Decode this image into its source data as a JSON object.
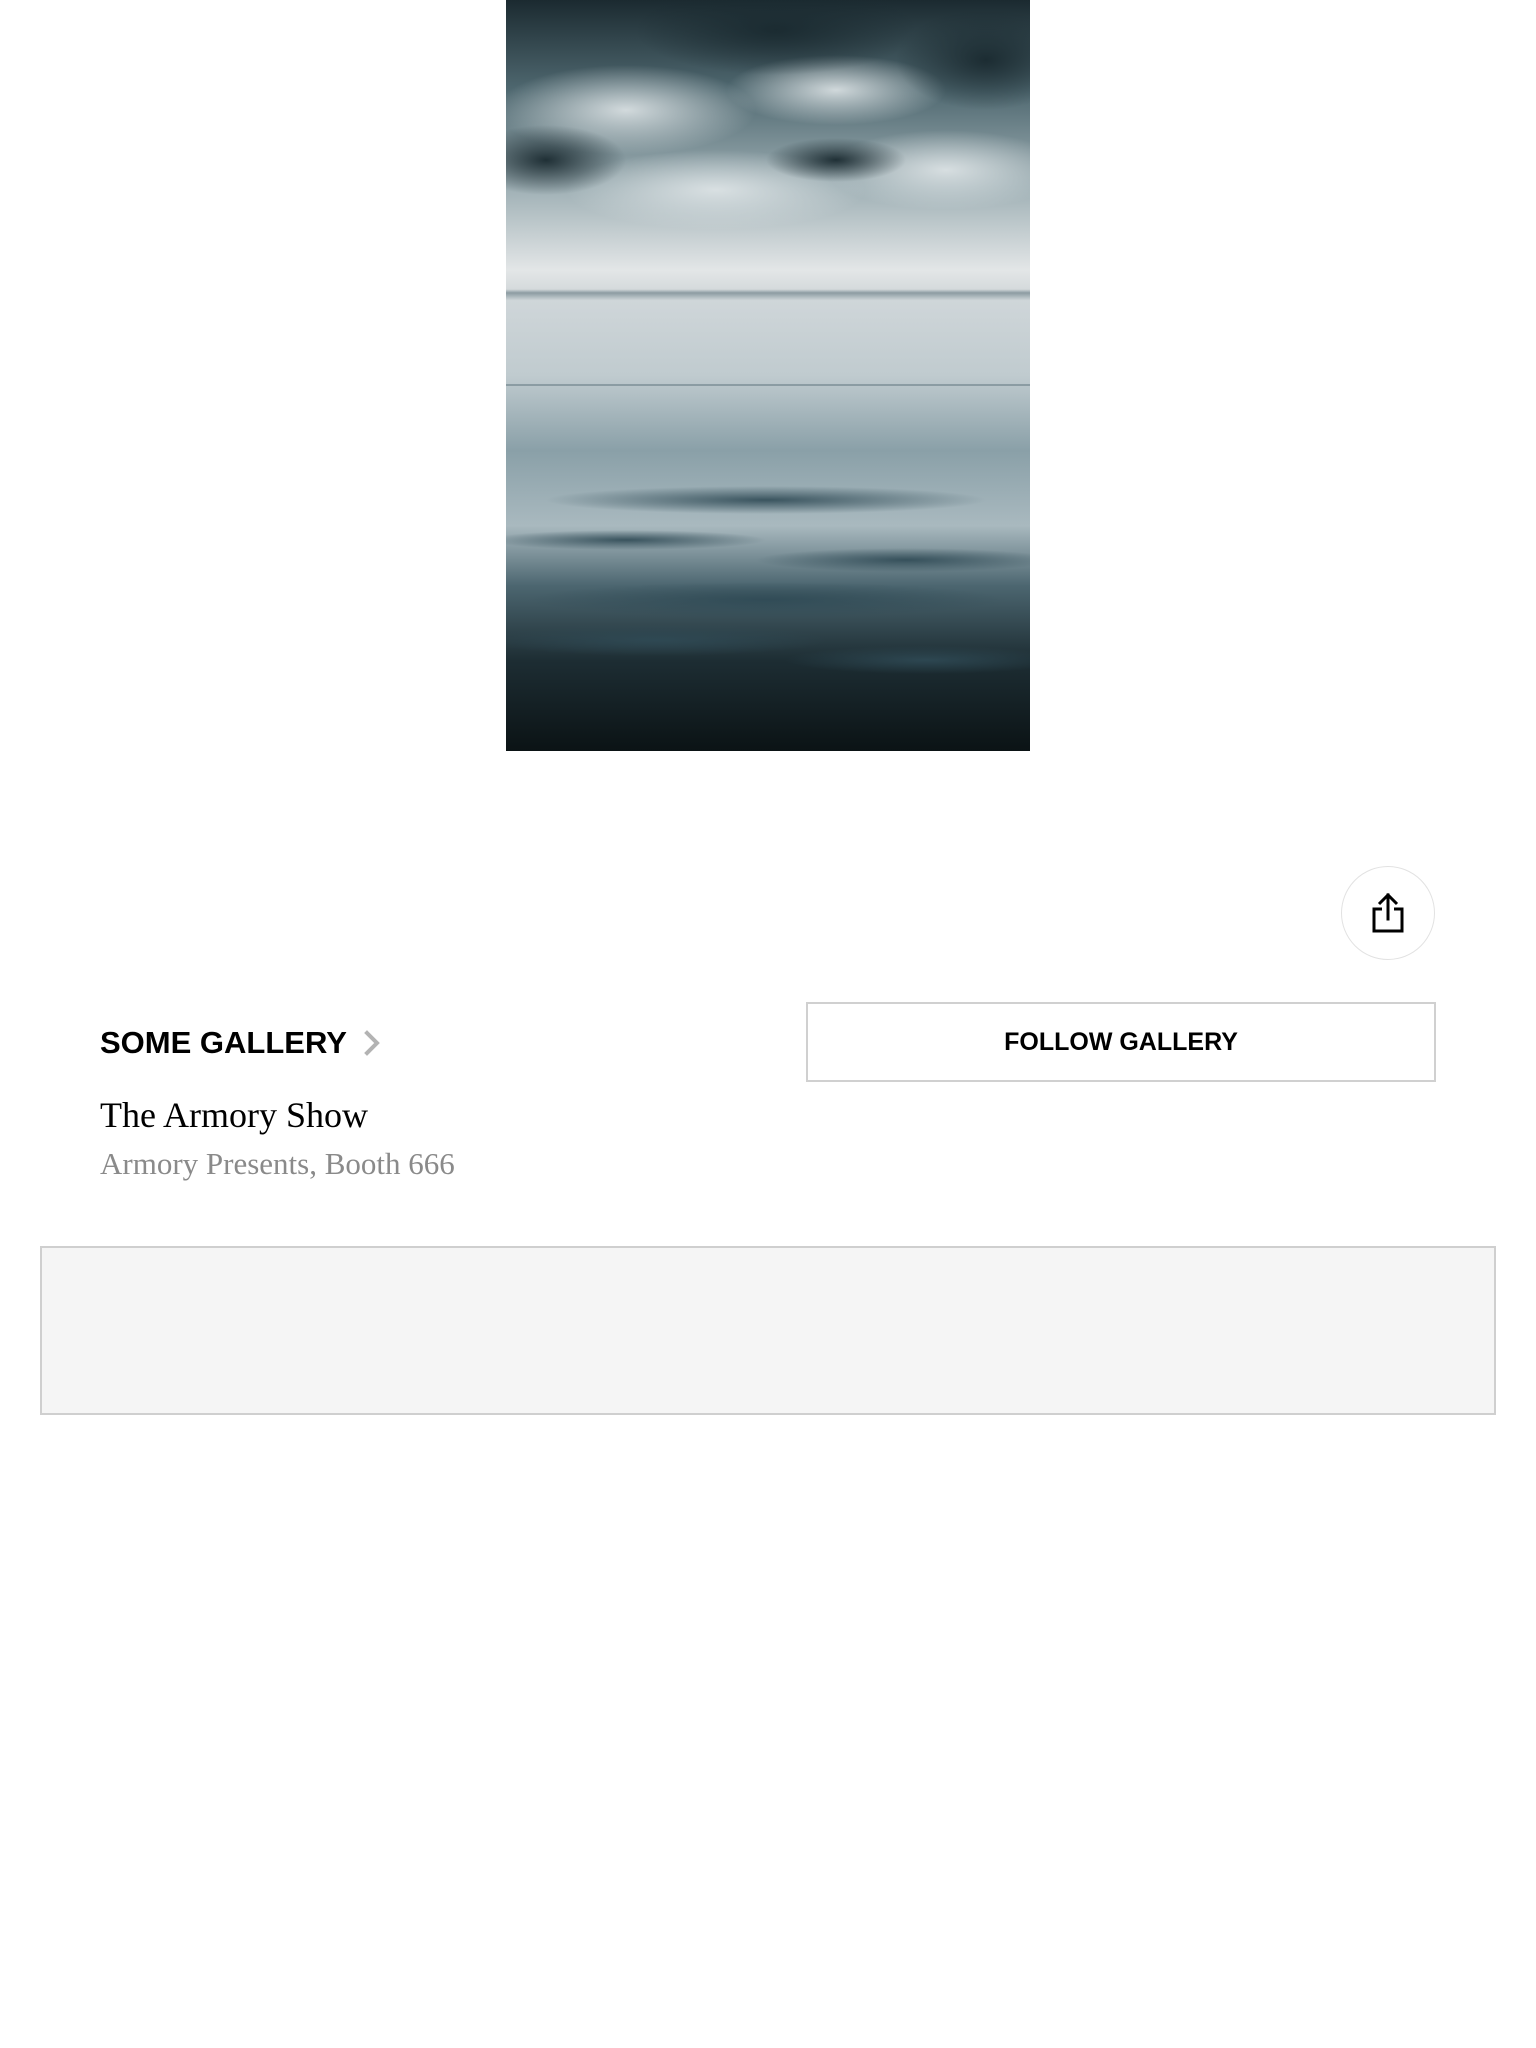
{
  "artwork": {
    "image_icon": "seascape-painting",
    "colors": {
      "sky_dark": "#1f3036",
      "sky_light": "#dfe3e5",
      "sea_mid": "#6f8993",
      "sea_dark": "#0d1618"
    }
  },
  "actions": {
    "share_icon": "share-icon"
  },
  "partner": {
    "name": "SOME GALLERY",
    "chevron_icon": "chevron-right-icon",
    "follow_label": "FOLLOW GALLERY"
  },
  "fair": {
    "name": "The Armory Show",
    "location": "Armory Presents, Booth 666"
  },
  "colors": {
    "border": "#d0d0d0",
    "placeholder_bg": "#f5f5f5",
    "secondary_text": "#8a8a8a",
    "chevron": "#b3b3b3"
  }
}
